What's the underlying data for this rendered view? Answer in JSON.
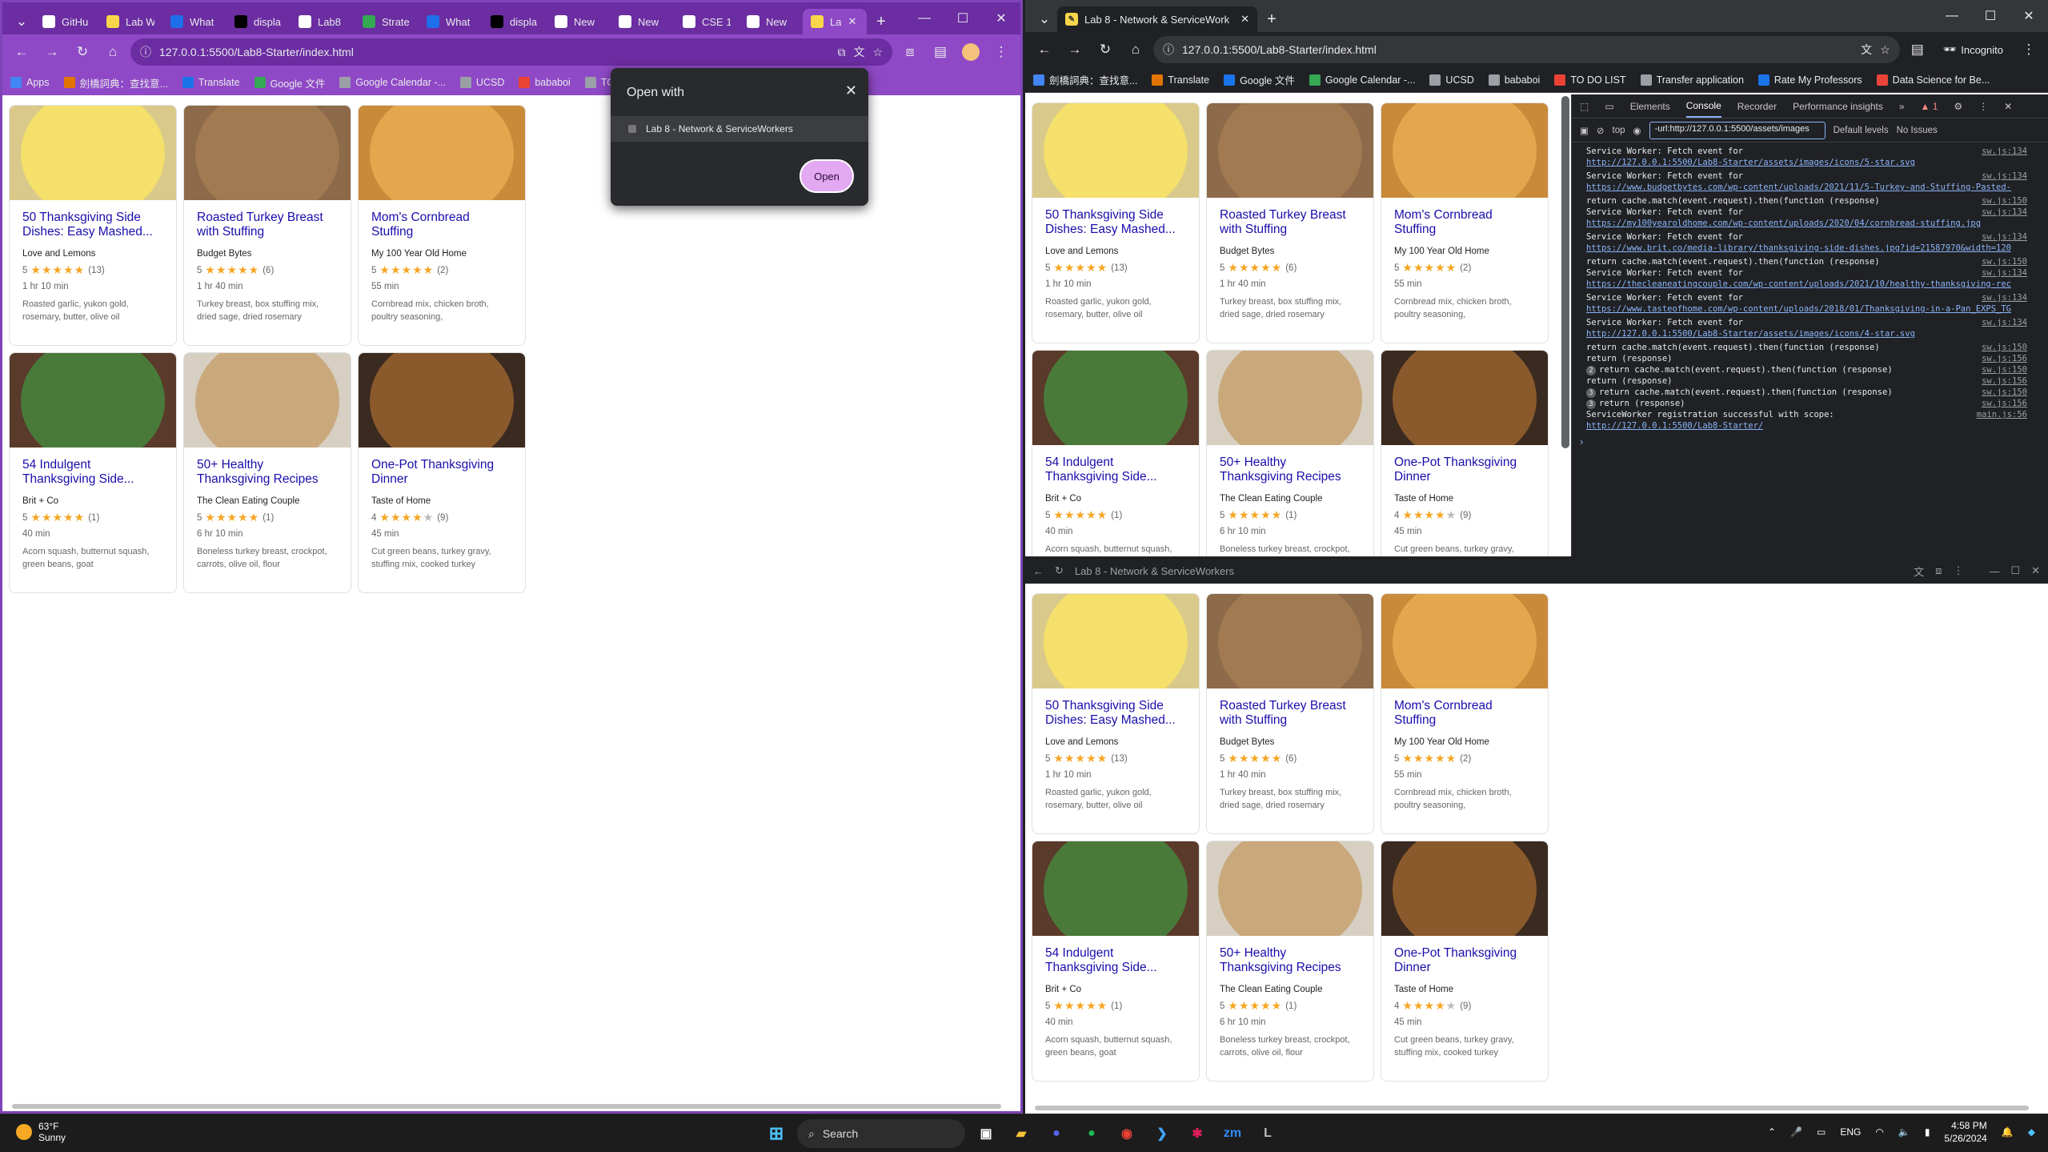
{
  "left_window": {
    "tabs": [
      {
        "label": "GitHu",
        "icon": "github-icon",
        "color": "#ffffff"
      },
      {
        "label": "Lab W",
        "icon": "lab-icon",
        "color": "#f9d649"
      },
      {
        "label": "What",
        "icon": "canvas-icon",
        "color": "#1f6feb"
      },
      {
        "label": "displa",
        "icon": "medium-icon",
        "color": "#000000"
      },
      {
        "label": "Lab8",
        "icon": "github-icon",
        "color": "#ffffff"
      },
      {
        "label": "Strate",
        "icon": "chrome-icon",
        "color": "#34a853"
      },
      {
        "label": "What",
        "icon": "canvas-icon",
        "color": "#1f6feb"
      },
      {
        "label": "displa",
        "icon": "medium-icon",
        "color": "#000000"
      },
      {
        "label": "New",
        "icon": "chatgpt-icon",
        "color": "#ffffff"
      },
      {
        "label": "New",
        "icon": "chatgpt-icon",
        "color": "#ffffff"
      },
      {
        "label": "CSE 1",
        "icon": "sandbox-icon",
        "color": "#ffffff"
      },
      {
        "label": "New",
        "icon": "chatgpt-icon",
        "color": "#ffffff"
      },
      {
        "label": "La",
        "icon": "lab-icon",
        "color": "#f9d649"
      }
    ],
    "url": "127.0.0.1:5500/Lab8-Starter/index.html",
    "bookmarks": [
      "Apps",
      "劍橋詞典：查找意...",
      "Translate",
      "Google 文件",
      "Google Calendar -...",
      "UCSD",
      "bababoi",
      "TO D"
    ],
    "dialog": {
      "title": "Open with",
      "option": "Lab 8 - Network & ServiceWorkers",
      "button": "Open"
    }
  },
  "right_window": {
    "tab_title": "Lab 8 - Network & ServiceWork",
    "url": "127.0.0.1:5500/Lab8-Starter/index.html",
    "incognito": "Incognito",
    "bookmarks": [
      "劍橋詞典：查找意...",
      "Translate",
      "Google 文件",
      "Google Calendar -...",
      "UCSD",
      "bababoi",
      "TO DO LIST",
      "Transfer application",
      "Rate My Professors",
      "Data Science for Be..."
    ]
  },
  "app_window": {
    "title": "Lab 8 - Network & ServiceWorkers"
  },
  "recipes": [
    {
      "title": "50 Thanksgiving Side Dishes: Easy Mashed...",
      "source": "Love and Lemons",
      "rating": "5",
      "stars": 5,
      "count": "(13)",
      "time": "1 hr 10 min",
      "ingredients": "Roasted garlic, yukon gold, rosemary, butter, olive oil",
      "bg": "#d9c98a",
      "plate": "#f4e06a"
    },
    {
      "title": "Roasted Turkey Breast with Stuffing",
      "source": "Budget Bytes",
      "rating": "5",
      "stars": 5,
      "count": "(6)",
      "time": "1 hr 40 min",
      "ingredients": "Turkey breast, box stuffing mix, dried sage, dried rosemary",
      "bg": "#8c6a4a",
      "plate": "#a27a52"
    },
    {
      "title": "Mom's Cornbread Stuffing",
      "source": "My 100 Year Old Home",
      "rating": "5",
      "stars": 5,
      "count": "(2)",
      "time": "55 min",
      "ingredients": "Cornbread mix, chicken broth, poultry seasoning,",
      "bg": "#c98a3a",
      "plate": "#e3a84e"
    },
    {
      "title": "54 Indulgent Thanksgiving Side...",
      "source": "Brit + Co",
      "rating": "5",
      "stars": 5,
      "count": "(1)",
      "time": "40 min",
      "ingredients": "Acorn squash, butternut squash, green beans, goat",
      "bg": "#5a3a2a",
      "plate": "#4a7a3a"
    },
    {
      "title": "50+ Healthy Thanksgiving Recipes",
      "source": "The Clean Eating Couple",
      "rating": "5",
      "stars": 5,
      "count": "(1)",
      "time": "6 hr 10 min",
      "ingredients": "Boneless turkey breast, crockpot, carrots, olive oil, flour",
      "bg": "#d6cfc2",
      "plate": "#c9a87c"
    },
    {
      "title": "One-Pot Thanksgiving Dinner",
      "source": "Taste of Home",
      "rating": "4",
      "stars": 4,
      "count": "(9)",
      "time": "45 min",
      "ingredients": "Cut green beans, turkey gravy, stuffing mix, cooked turkey",
      "bg": "#3b2a20",
      "plate": "#8a5a2c"
    }
  ],
  "devtools": {
    "tabs": [
      "Elements",
      "Console",
      "Recorder",
      "Performance insights"
    ],
    "active_tab": "Console",
    "context": "top",
    "filter": "-url:http://127.0.0.1:5500/assets/images",
    "levels": "Default levels",
    "issues": "No Issues",
    "warn_count": "1",
    "log": [
      {
        "text": "Service Worker: Fetch event for",
        "src": "sw.js:134"
      },
      {
        "text": "http://127.0.0.1:5500/Lab8-Starter/assets/images/icons/5-star.svg",
        "src": "",
        "link": true
      },
      {
        "text": "Service Worker: Fetch event for",
        "src": "sw.js:134"
      },
      {
        "text": "https://www.budgetbytes.com/wp-content/uploads/2021/11/5-Turkey-and-Stuffing-Pasted-",
        "src": "",
        "link": true
      },
      {
        "text": "return cache.match(event.request).then(function (response)",
        "src": "sw.js:150"
      },
      {
        "text": "Service Worker: Fetch event for",
        "src": "sw.js:134"
      },
      {
        "text": "https://my100yearoldhome.com/wp-content/uploads/2020/04/cornbread-stuffing.jpg",
        "src": "",
        "link": true
      },
      {
        "text": "Service Worker: Fetch event for",
        "src": "sw.js:134"
      },
      {
        "text": "https://www.brit.co/media-library/thanksgiving-side-dishes.jpg?id=21587970&width=120",
        "src": "",
        "link": true
      },
      {
        "text": "return cache.match(event.request).then(function (response)",
        "src": "sw.js:150"
      },
      {
        "text": "Service Worker: Fetch event for",
        "src": "sw.js:134"
      },
      {
        "text": "https://thecleaneatingcouple.com/wp-content/uploads/2021/10/healthy-thanksgiving-rec",
        "src": "",
        "link": true
      },
      {
        "text": "Service Worker: Fetch event for",
        "src": "sw.js:134"
      },
      {
        "text": "https://www.tasteofhome.com/wp-content/uploads/2018/01/Thanksgiving-in-a-Pan_EXPS_TG",
        "src": "",
        "link": true
      },
      {
        "text": "Service Worker: Fetch event for",
        "src": "sw.js:134"
      },
      {
        "text": "http://127.0.0.1:5500/Lab8-Starter/assets/images/icons/4-star.svg",
        "src": "",
        "link": true
      },
      {
        "text": "return cache.match(event.request).then(function (response)",
        "src": "sw.js:150"
      },
      {
        "text": "return (response)",
        "src": "sw.js:156"
      },
      {
        "text": "return cache.match(event.request).then(function (response)",
        "src": "sw.js:150",
        "badge": "2"
      },
      {
        "text": "return (response)",
        "src": "sw.js:156"
      },
      {
        "text": "return cache.match(event.request).then(function (response)",
        "src": "sw.js:150",
        "badge": "3"
      },
      {
        "text": "return (response)",
        "src": "sw.js:156",
        "badge": "3"
      },
      {
        "text": "ServiceWorker registration successful with scope:",
        "src": "main.js:56"
      },
      {
        "text": "http://127.0.0.1:5500/Lab8-Starter/",
        "src": "",
        "link": true
      }
    ]
  },
  "taskbar": {
    "temp": "63°F",
    "weather": "Sunny",
    "search": "Search",
    "lang": "ENG",
    "time": "4:58 PM",
    "date": "5/26/2024"
  }
}
